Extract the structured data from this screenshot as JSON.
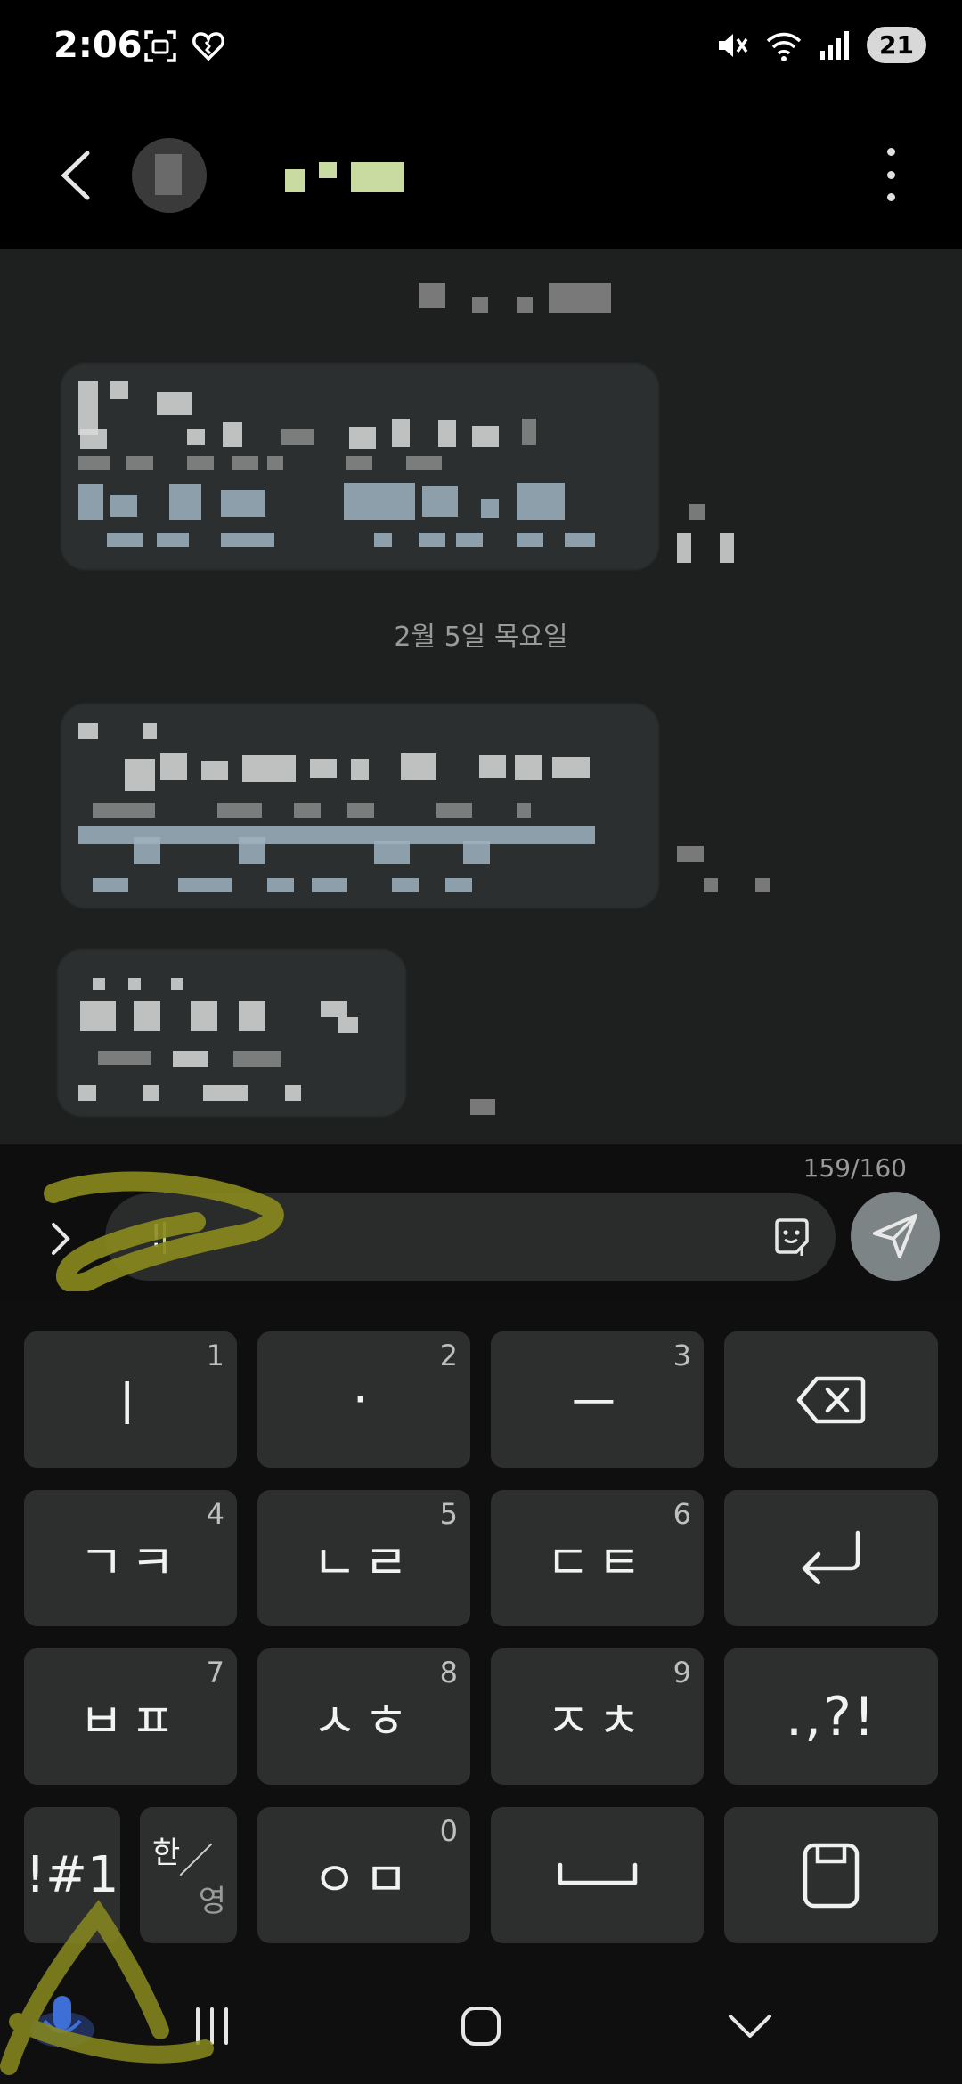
{
  "status_bar": {
    "time": "2:06",
    "battery": "21",
    "icons": [
      "screenshot-icon",
      "heart-icon",
      "mute-icon",
      "wifi-icon",
      "signal-icon"
    ]
  },
  "header": {
    "icons": [
      "back-icon",
      "avatar",
      "more-icon"
    ]
  },
  "chat": {
    "date_separator": "2월 5일 목요일"
  },
  "composer": {
    "counter": "159/160",
    "text": "!",
    "icons": [
      "expand-icon",
      "sticker-icon",
      "send-icon"
    ],
    "accent_color": "#c9e074"
  },
  "keyboard": {
    "rows": [
      [
        {
          "label": "ㅣ",
          "number": "1"
        },
        {
          "label": "·",
          "number": "2"
        },
        {
          "label": "ㅡ",
          "number": "3"
        },
        {
          "label": "",
          "icon": "backspace-icon"
        }
      ],
      [
        {
          "label": "ㄱㅋ",
          "number": "4"
        },
        {
          "label": "ㄴㄹ",
          "number": "5"
        },
        {
          "label": "ㄷㅌ",
          "number": "6"
        },
        {
          "label": "",
          "icon": "enter-icon"
        }
      ],
      [
        {
          "label": "ㅂㅍ",
          "number": "7"
        },
        {
          "label": "ㅅㅎ",
          "number": "8"
        },
        {
          "label": "ㅈㅊ",
          "number": "9"
        },
        {
          "label": ".,?!"
        }
      ],
      [
        {
          "label": "!#1"
        },
        {
          "label_top": "한",
          "label_bottom": "영"
        },
        {
          "label": "ㅇㅁ",
          "number": "0"
        },
        {
          "label": "",
          "icon": "space-icon"
        },
        {
          "label": "",
          "icon": "clipboard-icon"
        }
      ]
    ]
  },
  "nav_bar": {
    "icons": [
      "microphone-icon",
      "recent-apps-icon",
      "home-icon",
      "hide-keyboard-icon"
    ]
  },
  "colors": {
    "background": "#000000",
    "chat_background": "#1e1f1f",
    "key_background": "#2d2e2e",
    "send_button": "#7d8486",
    "annotation": "#8a8a1e"
  }
}
